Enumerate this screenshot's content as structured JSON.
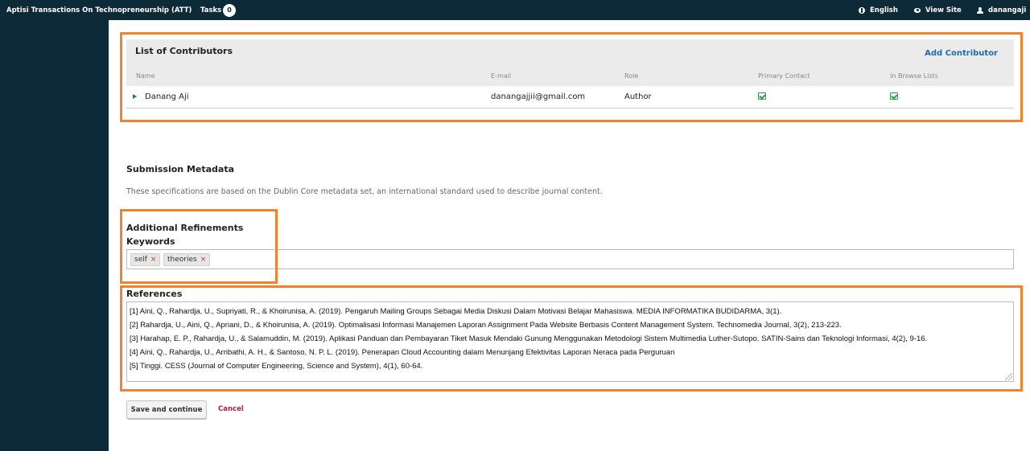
{
  "topbar": {
    "app_title": "Aptisi Transactions On Technopreneurship (ATT)",
    "tasks_label": "Tasks",
    "tasks_count": "0",
    "language": "English",
    "view_site": "View Site",
    "username": "danangaji"
  },
  "contributors": {
    "title": "List of Contributors",
    "add_label": "Add Contributor",
    "columns": [
      "Name",
      "E-mail",
      "Role",
      "Primary Contact",
      "In Browse Lists"
    ],
    "rows": [
      {
        "name": "Danang Aji",
        "email": "danangajjii@gmail.com",
        "role": "Author",
        "primary_contact": true,
        "in_browse_lists": true
      }
    ]
  },
  "metadata": {
    "title": "Submission Metadata",
    "description": "These specifications are based on the Dublin Core metadata set, an international standard used to describe journal content."
  },
  "refinements": {
    "title": "Additional Refinements",
    "keywords_label": "Keywords",
    "keywords": [
      "self",
      "theories"
    ],
    "tag_remove_glyph": "×"
  },
  "references": {
    "label": "References",
    "lines": [
      "[1] Aini, Q., Rahardja, U., Supriyati, R., & Khoirunisa, A. (2019). Pengaruh Mailing Groups Sebagai Media Diskusi Dalam Motivasi Belajar Mahasiswa. MEDIA INFORMATIKA BUDIDARMA, 3(1).",
      "[2] Rahardja, U., Aini, Q., Apriani, D., & Khoirunisa, A. (2019). Optimalisasi Informasi Manajemen Laporan Assignment Pada Website Berbasis Content Management System. Technomedia Journal, 3(2), 213-223.",
      "[3] Harahap, E. P., Rahardja, U., & Salamuddin, M. (2019). Aplikasi Panduan dan Pembayaran Tiket Masuk Mendaki Gunung Menggunakan Metodologi Sistem Multimedia Luther-Sutopo. SATIN-Sains dan Teknologi Informasi, 4(2), 9-16.",
      "[4] Aini, Q., Rahardja, U., Arribathi, A. H., & Santoso, N. P. L. (2019). Penerapan Cloud Accounting dalam Menunjang Efektivitas Laporan Neraca pada Perguruan",
      "[5] Tinggi. CESS (Journal of Computer Engineering, Science and System), 4(1), 60-64."
    ]
  },
  "actions": {
    "save_label": "Save and continue",
    "cancel_label": "Cancel"
  },
  "colors": {
    "topbar_bg": "#0d2a38",
    "highlight": "#f5822a",
    "link": "#1a6fa8",
    "check": "#2e9a4b",
    "cancel": "#c0164a"
  }
}
